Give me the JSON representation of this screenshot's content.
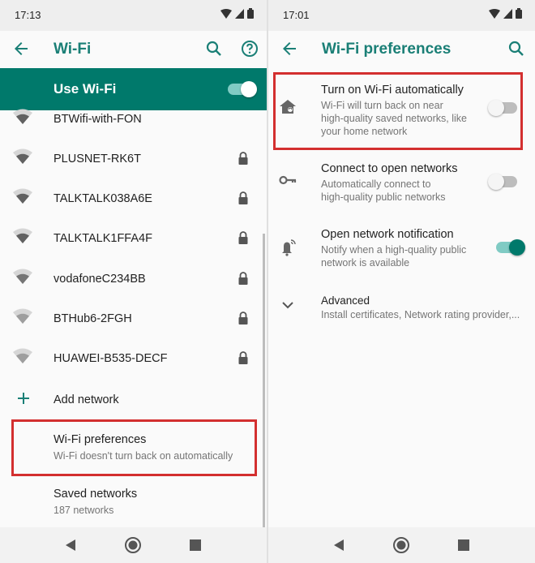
{
  "left": {
    "status": {
      "time": "17:13"
    },
    "appbar": {
      "title": "Wi-Fi"
    },
    "master_toggle": {
      "label": "Use Wi-Fi",
      "on": true
    },
    "networks": [
      {
        "name": "BTWifi-with-FON",
        "locked": false
      },
      {
        "name": "PLUSNET-RK6T",
        "locked": true
      },
      {
        "name": "TALKTALK038A6E",
        "locked": true
      },
      {
        "name": "TALKTALK1FFA4F",
        "locked": true
      },
      {
        "name": "vodafoneC234BB",
        "locked": true
      },
      {
        "name": "BTHub6-2FGH",
        "locked": true
      },
      {
        "name": "HUAWEI-B535-DECF",
        "locked": true
      }
    ],
    "add_network": {
      "label": "Add network"
    },
    "wifi_preferences": {
      "title": "Wi-Fi preferences",
      "subtitle": "Wi-Fi doesn't turn back on automatically"
    },
    "saved_networks": {
      "title": "Saved networks",
      "subtitle": "187 networks"
    }
  },
  "right": {
    "status": {
      "time": "17:01"
    },
    "appbar": {
      "title": "Wi-Fi preferences"
    },
    "prefs": [
      {
        "title": "Turn on Wi-Fi automatically",
        "subtitle_lines": [
          "Wi-Fi will turn back on near",
          "high-quality saved networks, like",
          "your home network"
        ],
        "on": false,
        "icon": "home-wifi-icon"
      },
      {
        "title": "Connect to open networks",
        "subtitle_lines": [
          "Automatically connect to",
          "high-quality public networks"
        ],
        "on": false,
        "icon": "key-icon"
      },
      {
        "title": "Open network notification",
        "subtitle_lines": [
          "Notify when a high-quality public",
          "network is available"
        ],
        "on": true,
        "icon": "bell-wifi-icon"
      }
    ],
    "advanced": {
      "title": "Advanced",
      "subtitle": "Install certificates, Network rating provider,..."
    }
  },
  "colors": {
    "accent": "#00796b",
    "title_teal": "#1a7f76",
    "highlight": "#d32f2f",
    "status_bar": "#eeeeee"
  }
}
